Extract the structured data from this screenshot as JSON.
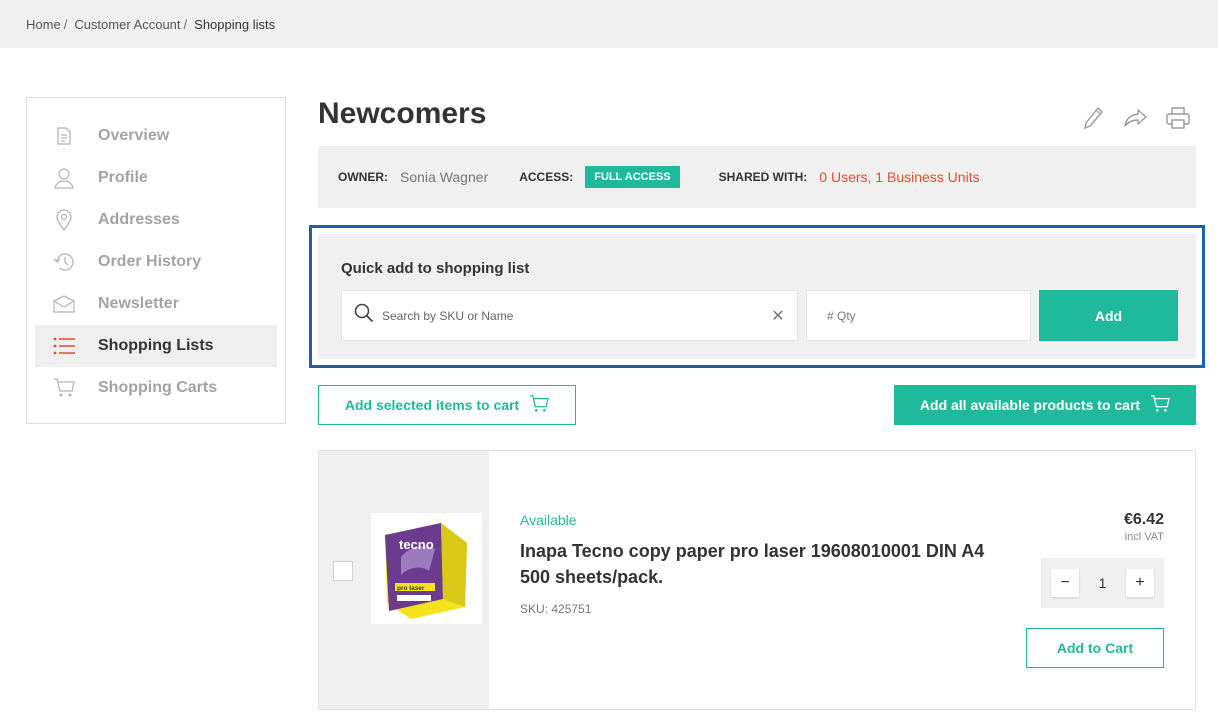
{
  "breadcrumb": {
    "items": [
      "Home",
      "Customer Account",
      "Shopping lists"
    ],
    "separator": "/"
  },
  "sidebar": {
    "items": [
      {
        "label": "Overview",
        "icon": "document-icon"
      },
      {
        "label": "Profile",
        "icon": "user-icon"
      },
      {
        "label": "Addresses",
        "icon": "location-pin-icon"
      },
      {
        "label": "Order History",
        "icon": "history-icon"
      },
      {
        "label": "Newsletter",
        "icon": "envelope-icon"
      },
      {
        "label": "Shopping Lists",
        "icon": "list-icon",
        "active": true
      },
      {
        "label": "Shopping Carts",
        "icon": "cart-icon"
      }
    ]
  },
  "list": {
    "title": "Newcomers",
    "actions": [
      "edit-icon",
      "share-icon",
      "print-icon"
    ]
  },
  "info": {
    "owner_label": "OWNER:",
    "owner_value": "Sonia Wagner",
    "access_label": "ACCESS:",
    "access_value": "FULL ACCESS",
    "shared_label": "SHARED WITH:",
    "shared_value": "0 Users, 1 Business Units"
  },
  "quick_add": {
    "title": "Quick add to shopping list",
    "search_placeholder": "Search by SKU or Name",
    "qty_placeholder": "# Qty",
    "add_label": "Add"
  },
  "actions": {
    "add_selected_label": "Add selected items to cart",
    "add_all_label": "Add all available products to cart"
  },
  "products": [
    {
      "availability": "Available",
      "name": "Inapa Tecno copy paper pro laser 19608010001 DIN A4 500 sheets/pack.",
      "sku": "SKU: 425751",
      "price": "€6.42",
      "vat": "incl VAT",
      "quantity": "1",
      "add_to_cart_label": "Add to Cart",
      "qty_minus": "−",
      "qty_plus": "+"
    }
  ],
  "colors": {
    "accent": "#1fba9b",
    "link": "#e04e2f",
    "focus_border": "#1762a8",
    "panel_bg": "#f0f0f0"
  }
}
